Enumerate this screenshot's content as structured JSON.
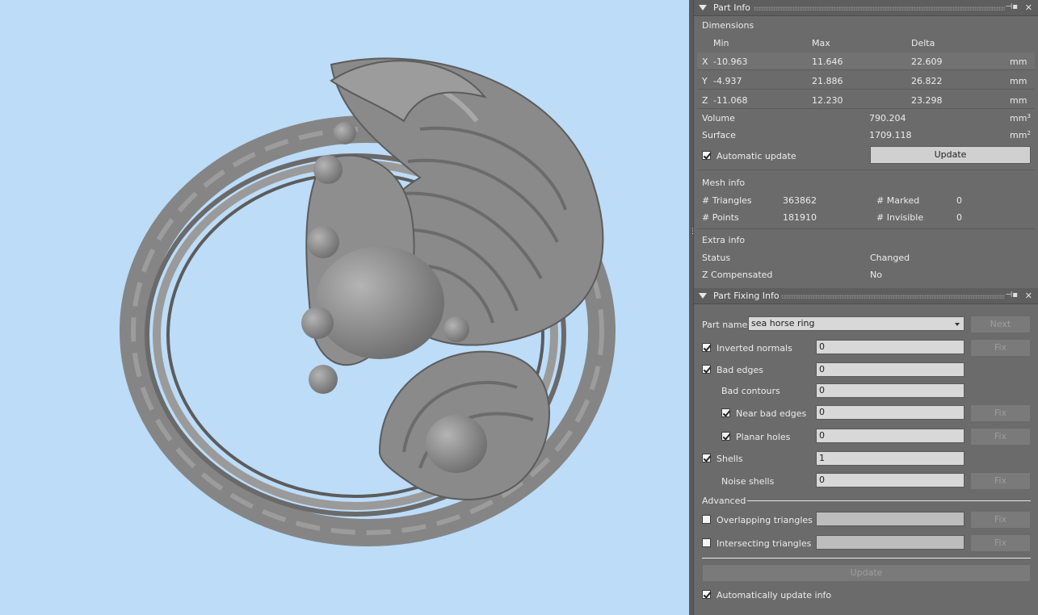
{
  "part_info": {
    "title": "Part Info",
    "dimensions": {
      "group_label": "Dimensions",
      "headers": {
        "min": "Min",
        "max": "Max",
        "delta": "Delta"
      },
      "rows": [
        {
          "axis": "X",
          "min": "-10.963",
          "max": "11.646",
          "delta": "22.609",
          "unit": "mm"
        },
        {
          "axis": "Y",
          "min": "-4.937",
          "max": "21.886",
          "delta": "26.822",
          "unit": "mm"
        },
        {
          "axis": "Z",
          "min": "-11.068",
          "max": "12.230",
          "delta": "23.298",
          "unit": "mm"
        }
      ],
      "volume_label": "Volume",
      "volume_value": "790.204",
      "volume_unit": "mm",
      "volume_unit_sup": "3",
      "surface_label": "Surface",
      "surface_value": "1709.118",
      "surface_unit": "mm",
      "surface_unit_sup": "2",
      "auto_update_label": "Automatic update",
      "auto_update_checked": true,
      "update_button": "Update"
    },
    "mesh_info": {
      "group_label": "Mesh info",
      "triangles_label": "# Triangles",
      "triangles_value": "363862",
      "points_label": "# Points",
      "points_value": "181910",
      "marked_label": "# Marked",
      "marked_value": "0",
      "invisible_label": "# Invisible",
      "invisible_value": "0"
    },
    "extra_info": {
      "group_label": "Extra info",
      "status_label": "Status",
      "status_value": "Changed",
      "zcomp_label": "Z Compensated",
      "zcomp_value": "No"
    }
  },
  "part_fixing": {
    "title": "Part Fixing Info",
    "part_name_label": "Part name",
    "part_name_value": "sea horse ring",
    "next_button": "Next",
    "fix_label": "Fix",
    "rows": {
      "inverted_normals": {
        "label": "Inverted normals",
        "value": "0",
        "checked": true
      },
      "bad_edges": {
        "label": "Bad edges",
        "value": "0",
        "checked": true
      },
      "bad_contours": {
        "label": "Bad contours",
        "value": "0"
      },
      "near_bad_edges": {
        "label": "Near bad edges",
        "value": "0",
        "checked": true
      },
      "planar_holes": {
        "label": "Planar holes",
        "value": "0",
        "checked": true
      },
      "shells": {
        "label": "Shells",
        "value": "1",
        "checked": true
      },
      "noise_shells": {
        "label": "Noise shells",
        "value": "0"
      }
    },
    "advanced_label": "Advanced",
    "overlapping_label": "Overlapping triangles",
    "intersecting_label": "Intersecting triangles",
    "update_button": "Update",
    "auto_update_info_label": "Automatically update info",
    "auto_update_info_checked": true
  },
  "colors": {
    "viewport_bg": "#bcdcf8",
    "panel_bg": "#6b6b6b",
    "model": "#8c8c8c"
  }
}
